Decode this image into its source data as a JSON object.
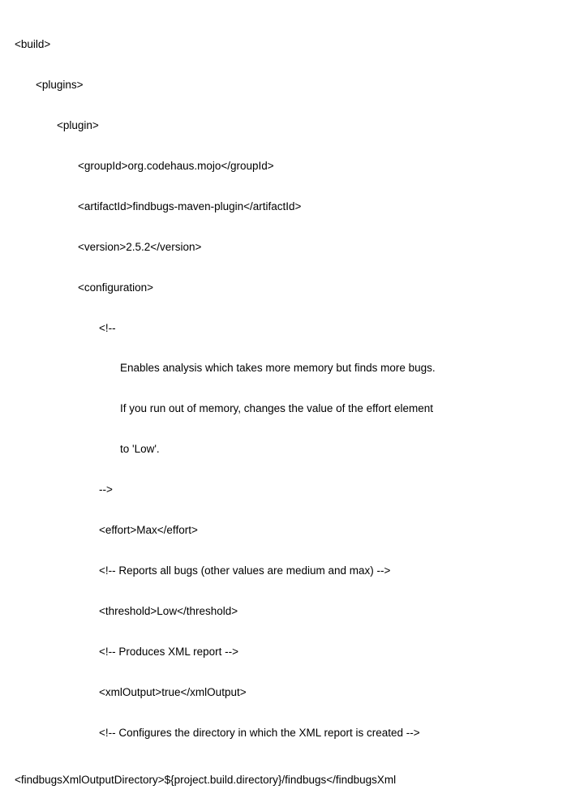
{
  "lines": {
    "l00": "<build>",
    "l01": "<plugins>",
    "l02": "<plugin>",
    "l03": "<groupId>org.codehaus.mojo</groupId>",
    "l04": "<artifactId>findbugs-maven-plugin</artifactId>",
    "l05": "<version>2.5.2</version>",
    "l06": "<configuration>",
    "l07": "<!--",
    "l08": "Enables analysis which takes more memory but finds more bugs.",
    "l09": "If you run out of memory, changes the value of the effort element",
    "l10": "to 'Low'.",
    "l11": "-->",
    "l12": "<effort>Max</effort>",
    "l13": "<!-- Reports all bugs (other values are medium and max) -->",
    "l14": "<threshold>Low</threshold>",
    "l15": "<!-- Produces XML report -->",
    "l16": "<xmlOutput>true</xmlOutput>",
    "l17": "<!-- Configures the directory in which the XML report is created -->",
    "l18": "<findbugsXmlOutputDirectory>${project.build.directory}/findbugs</findbugsXml"
  }
}
